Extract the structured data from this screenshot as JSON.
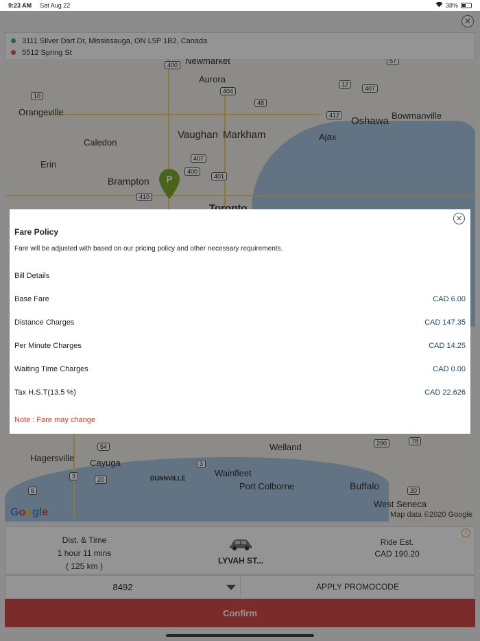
{
  "status_bar": {
    "time": "9:23 AM",
    "date": "Sat Aug 22",
    "battery": "38%"
  },
  "route": {
    "pickup": "3111 Silver Dart Dr, Mississauga, ON L5P 1B2, Canada",
    "dropoff": "5512 Spring St"
  },
  "map": {
    "labels": [
      "Newmarket",
      "Aurora",
      "Orangeville",
      "Oshawa",
      "Bowmanville",
      "Caledon",
      "Vaughan",
      "Markham",
      "Ajax",
      "Erin",
      "Brampton",
      "Toronto",
      "Welland",
      "Hagersville",
      "Cayuga",
      "Wainfleet",
      "Port Colborne",
      "Buffalo",
      "West Seneca",
      "DUNNVILLE"
    ],
    "shields": [
      "400",
      "404",
      "10",
      "12",
      "407",
      "57",
      "48",
      "412",
      "407",
      "400",
      "401",
      "410",
      "54",
      "3",
      "20",
      "6",
      "290",
      "78",
      "20",
      "3"
    ],
    "attribution": "Map data ©2020 Google",
    "logo": "Google",
    "pin_letter": "P"
  },
  "fare_policy": {
    "title": "Fare Policy",
    "description": "Fare will be adjusted with based on our pricing policy and other necessary requirements.",
    "bill_title": "Bill Details",
    "rows": [
      {
        "label": "Base Fare",
        "amount": "CAD 6.00"
      },
      {
        "label": "Distance Charges",
        "amount": "CAD 147.35"
      },
      {
        "label": "Per Minute Charges",
        "amount": "CAD 14.25"
      },
      {
        "label": "Waiting Time Charges",
        "amount": "CAD 0.00"
      },
      {
        "label": "Tax H.S.T(13.5 %)",
        "amount": "CAD 22.626"
      }
    ],
    "note": "Note : Fare may change"
  },
  "ride": {
    "dist_time_label": "Dist. & Time",
    "duration": "1 hour 11 mins",
    "distance": "( 125 km )",
    "vehicle": "LYVAH ST...",
    "estimate_label": "Ride Est.",
    "estimate": "CAD 190.20"
  },
  "payment": {
    "card": "8492",
    "promo_label": "APPLY PROMOCODE"
  },
  "confirm_label": "Confirm",
  "colors": {
    "accent": "#d64a4a",
    "pin": "#7fad2c",
    "note": "#e0331b",
    "amount": "#1e4960"
  }
}
